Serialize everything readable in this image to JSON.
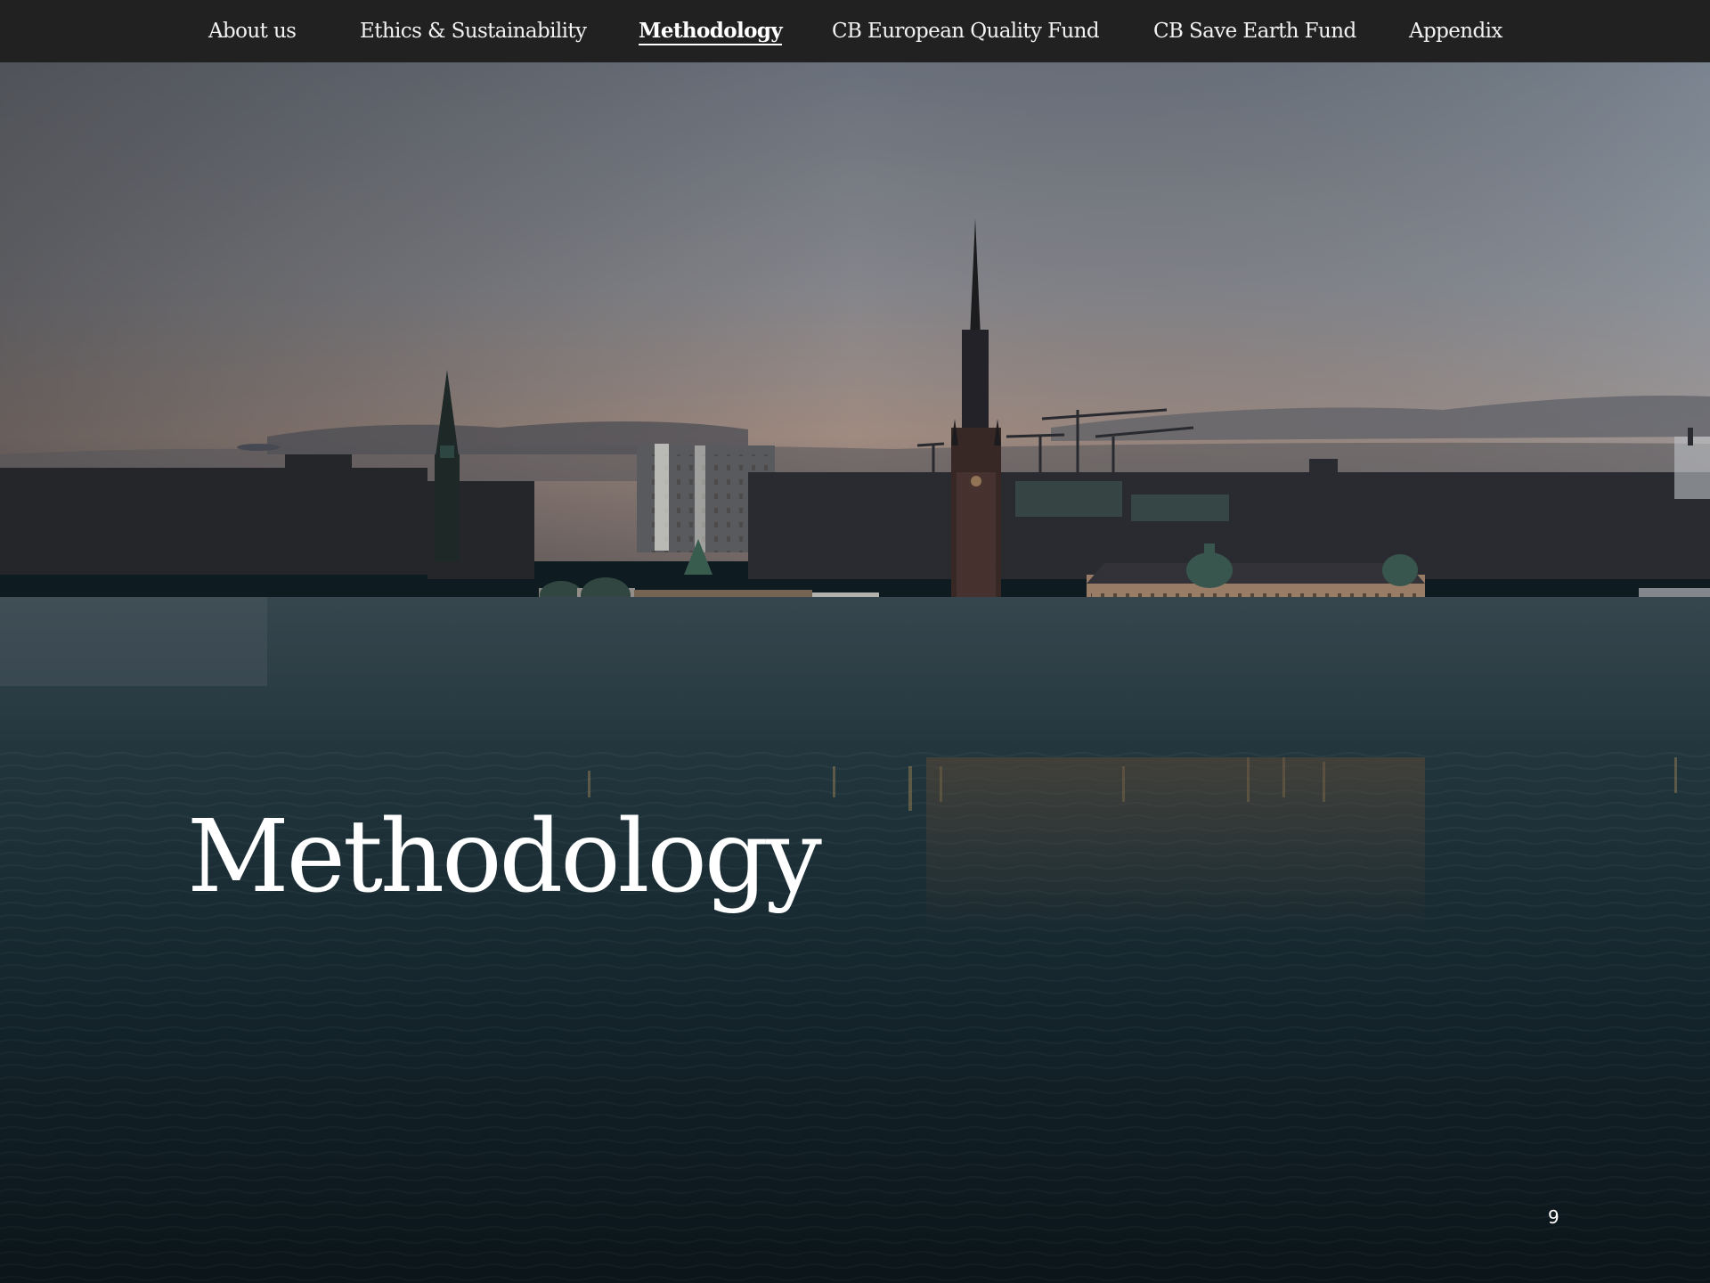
{
  "nav": {
    "items": [
      {
        "label": "About us",
        "active": false
      },
      {
        "label": "Ethics & Sustainability",
        "active": false
      },
      {
        "label": "Methodology",
        "active": true
      },
      {
        "label": "CB European Quality Fund",
        "active": false
      },
      {
        "label": "CB Save Earth Fund",
        "active": false
      },
      {
        "label": "Appendix",
        "active": false
      }
    ]
  },
  "hero": {
    "title": "Methodology",
    "background_image": "city-skyline-at-dusk-over-water"
  },
  "page_number": "9",
  "colors": {
    "nav_bg": "#212121",
    "nav_text": "#f2f2f2",
    "title_text": "#ffffff",
    "water": "#1a2d35",
    "sky_top": "#8a8e97",
    "sky_horizon": "#b79d8f"
  }
}
